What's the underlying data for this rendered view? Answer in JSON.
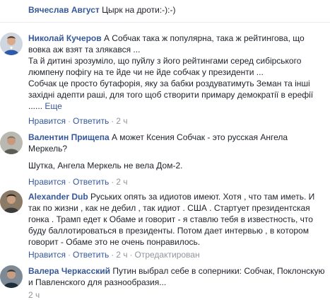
{
  "comments": [
    {
      "author": "Вячеслав Август",
      "text": "Цырк на дроти:-):-)"
    },
    {
      "author": "Николай Кучеров",
      "text_l1": "А Собчак така ж популярна, така ж рейтингова, що",
      "text_l2": "вовка аж взят та злякався ...",
      "text_l3": "Та й дитині зрозуміло, що пуйлу з його рейтингами серед сибірського",
      "text_l4": "люмпену пофігу на те йде чи не йде собчак у президенти ...",
      "text_l5": "Собчак це просто бутафорія, яку за бабки роздуватимуть Земан та інші",
      "text_l6": "західні адепти раші, для того щоб створити примару демократії в ерефії",
      "text_l7": "......",
      "more": "Еще",
      "actions": {
        "like": "Нравится",
        "reply": "Ответить",
        "time": "2 ч"
      }
    },
    {
      "author": "Валентин Прищепа",
      "text_l1": "А может Ксения Собчак - это русская Ангела",
      "text_l2": "Меркель?",
      "text_l3": "Шутка, Ангела Меркель не вела Дом-2.",
      "actions": {
        "like": "Нравится",
        "reply": "Ответить",
        "time": "2 ч"
      }
    },
    {
      "author": "Alexander Dub",
      "text_l1": "Руських опять за идиотов имеют. Хотя , что там иметь. И",
      "text_l2": "так по жизни , как не дебил , так идиот . США . Стартует президентская",
      "text_l3": "гонка . Трамп едет к Обаме и говорит - я ставлю тебя в известность, что",
      "text_l4": "буду баллотироваться в президенты. Потом дает интервью , в котором",
      "text_l5": "говорит - Обаме это не очень понравилось.",
      "actions": {
        "like": "Нравится",
        "reply": "Ответить",
        "time": "2 ч",
        "edited": "Отредактирован"
      }
    },
    {
      "author": "Валера Черкасский",
      "text_l1": "Путин выбрал себе в соперники: Собчак, Поклонскую",
      "text_l2": "и Павленского для разнообразия...",
      "actions": {
        "time": "2 ч"
      }
    }
  ]
}
